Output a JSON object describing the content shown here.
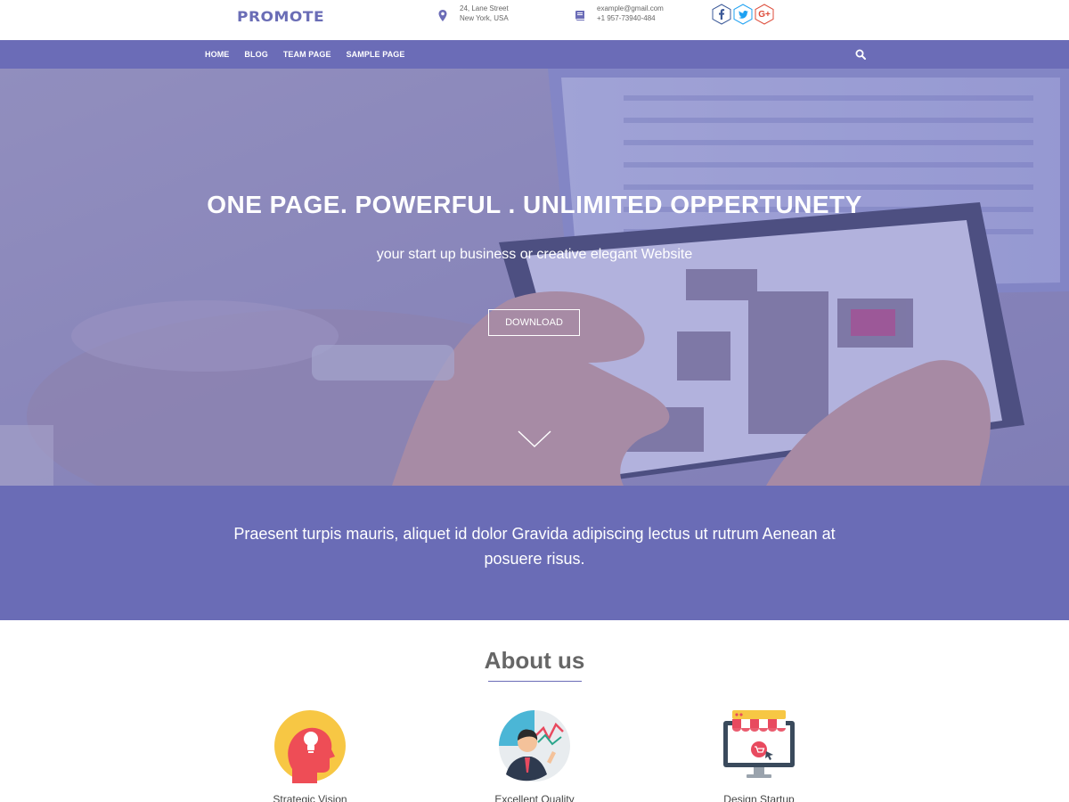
{
  "header": {
    "logo": "PROMOTE",
    "address": {
      "line1": "24, Lane Street",
      "line2": "New York, USA",
      "icon": "map-pin-icon"
    },
    "contact": {
      "line1": "example@gmail.com",
      "line2": "+1 957-73940-484",
      "icon": "book-icon"
    },
    "socials": [
      {
        "name": "facebook-icon",
        "glyph": "f",
        "color": "#3b5998"
      },
      {
        "name": "twitter-icon",
        "glyph": "t",
        "color": "#1da1f2"
      },
      {
        "name": "google-plus-icon",
        "glyph": "G+",
        "color": "#dd4b39"
      }
    ]
  },
  "nav": {
    "items": [
      "HOME",
      "BLOG",
      "TEAM PAGE",
      "SAMPLE PAGE"
    ],
    "search_icon": "search-icon"
  },
  "hero": {
    "title": "ONE PAGE. POWERFUL . UNLIMITED OPPERTUNETY",
    "subtitle": "your start up business or creative elegant Website",
    "button": "DOWNLOAD",
    "scroll_icon": "chevron-down-icon"
  },
  "band": {
    "text": "Praesent turpis mauris, aliquet id dolor Gravida adipiscing lectus ut rutrum Aenean at posuere risus."
  },
  "about": {
    "title": "About us",
    "features": [
      {
        "label": "Strategic Vision",
        "icon": "lightbulb-head-icon"
      },
      {
        "label": "Excellent Quality",
        "icon": "businessman-chart-icon"
      },
      {
        "label": "Design Startup",
        "icon": "online-shop-icon"
      }
    ]
  },
  "colors": {
    "brand": "#6b6cb7",
    "text_muted": "#666666"
  }
}
